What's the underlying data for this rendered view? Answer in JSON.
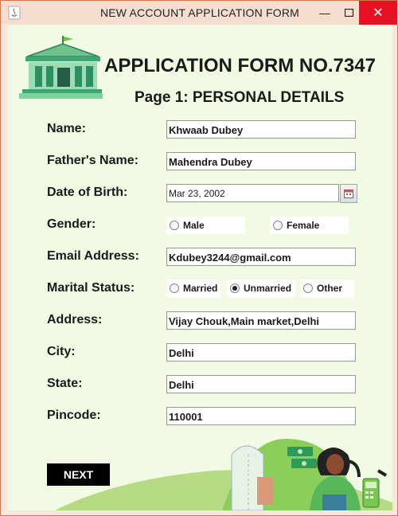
{
  "window": {
    "title": "NEW ACCOUNT APPLICATION FORM"
  },
  "header": {
    "title": "APPLICATION FORM NO.7347",
    "subtitle": "Page 1: PERSONAL DETAILS"
  },
  "form": {
    "name": {
      "label": "Name:",
      "value": "Khwaab Dubey"
    },
    "father": {
      "label": "Father's Name:",
      "value": "Mahendra Dubey"
    },
    "dob": {
      "label": "Date of Birth:",
      "value": "Mar 23, 2002"
    },
    "gender": {
      "label": "Gender:",
      "options": [
        "Male",
        "Female"
      ],
      "selected": null
    },
    "email": {
      "label": "Email Address:",
      "value": "Kdubey3244@gmail.com"
    },
    "marital": {
      "label": "Marital Status:",
      "options": [
        "Married",
        "Unmarried",
        "Other"
      ],
      "selected": "Unmarried"
    },
    "address": {
      "label": "Address:",
      "value": "Vijay Chouk,Main market,Delhi"
    },
    "city": {
      "label": "City:",
      "value": "Delhi"
    },
    "state": {
      "label": "State:",
      "value": "Delhi"
    },
    "pincode": {
      "label": "Pincode:",
      "value": "110001"
    }
  },
  "buttons": {
    "next": "NEXT"
  },
  "colors": {
    "background": "#f1fae3",
    "accent_green": "#6cc04a",
    "next_button": "#000000",
    "title_bar": "#f5ddd0",
    "close": "#e81123"
  }
}
